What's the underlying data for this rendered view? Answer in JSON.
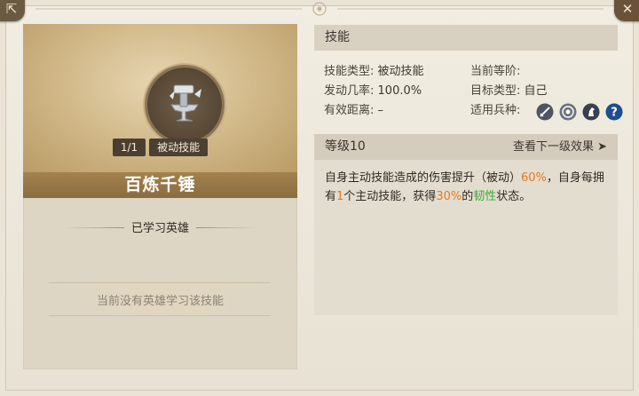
{
  "window": {
    "back_icon": "back-arrow-icon",
    "close_icon": "close-x-icon"
  },
  "skill": {
    "name": "百炼千锤",
    "level_count": "1/1",
    "kind": "被动技能",
    "icon": "anvil-hammer-icon"
  },
  "learned": {
    "heading": "已学习英雄",
    "empty_text": "当前没有英雄学习该技能"
  },
  "info": {
    "section_title": "技能",
    "type_label": "技能类型:",
    "type_value": "被动技能",
    "rate_label": "发动几率:",
    "rate_value": "100.0%",
    "range_label": "有效距离:",
    "range_value": "–",
    "stage_label": "当前等阶:",
    "stage_value": "",
    "target_label": "目标类型:",
    "target_value": "自己",
    "units_label": "适用兵种:",
    "units": [
      {
        "icon": "sword-icon",
        "color": "#4b5563"
      },
      {
        "icon": "target-icon",
        "color": "#6b7280"
      },
      {
        "icon": "horse-icon",
        "color": "#374151"
      },
      {
        "icon": "question-icon",
        "color": "#1e4e8c"
      }
    ]
  },
  "level": {
    "label": "等级10",
    "next_link": "查看下一级效果 ➤"
  },
  "description": {
    "p1": "自身主动技能造成的伤害提升（被动）",
    "v1": "60%",
    "p2": "，自身每拥有",
    "v2": "1",
    "p3": "个主动技能，获得",
    "v3": "30%",
    "p4": "的",
    "v4": "韧性",
    "p5": "状态。"
  },
  "colors": {
    "highlight_orange": "#e07a1f",
    "highlight_green": "#3ea63a",
    "title_bar": "#9a7a48"
  }
}
